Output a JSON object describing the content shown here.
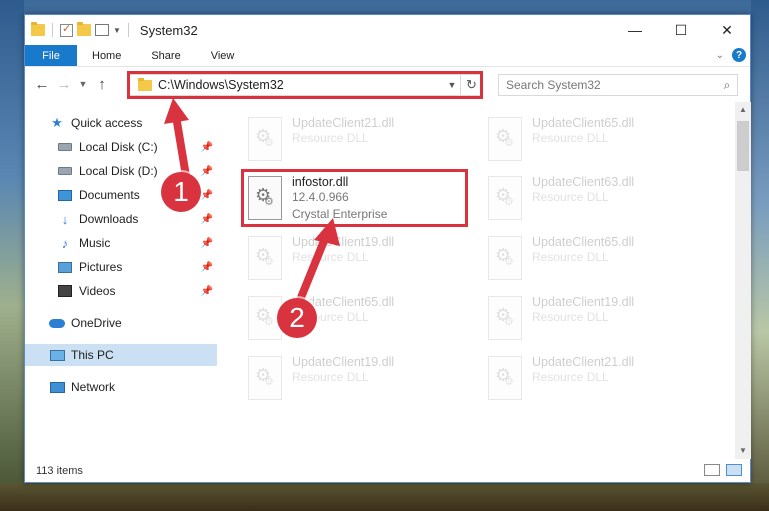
{
  "window": {
    "title": "System32",
    "controls": {
      "minimize": "—",
      "maximize": "☐",
      "close": "✕"
    }
  },
  "ribbon": {
    "tabs": [
      "File",
      "Home",
      "Share",
      "View"
    ],
    "help": "?"
  },
  "address": {
    "path": "C:\\Windows\\System32",
    "search_placeholder": "Search System32"
  },
  "sidebar": {
    "items": [
      {
        "label": "Quick access",
        "icon": "star-icon"
      },
      {
        "label": "Local Disk (C:)",
        "icon": "drive-icon",
        "pinned": true
      },
      {
        "label": "Local Disk (D:)",
        "icon": "drive-icon",
        "pinned": true
      },
      {
        "label": "Documents",
        "icon": "documents-icon",
        "pinned": true
      },
      {
        "label": "Downloads",
        "icon": "download-icon",
        "pinned": true
      },
      {
        "label": "Music",
        "icon": "music-icon",
        "pinned": true
      },
      {
        "label": "Pictures",
        "icon": "pictures-icon",
        "pinned": true
      },
      {
        "label": "Videos",
        "icon": "videos-icon",
        "pinned": true
      },
      {
        "label": "OneDrive",
        "icon": "onedrive-icon"
      },
      {
        "label": "This PC",
        "icon": "pc-icon",
        "selected": true
      },
      {
        "label": "Network",
        "icon": "network-icon"
      }
    ]
  },
  "files": [
    {
      "name": "UpdateClient21.dll",
      "sub1": "Resource DLL",
      "sub2": "",
      "faded": true
    },
    {
      "name": "UpdateClient65.dll",
      "sub1": "Resource DLL",
      "sub2": "",
      "faded": true
    },
    {
      "name": "infostor.dll",
      "sub1": "12.4.0.966",
      "sub2": "Crystal Enterprise",
      "faded": false
    },
    {
      "name": "UpdateClient63.dll",
      "sub1": "Resource DLL",
      "sub2": "",
      "faded": true
    },
    {
      "name": "UpdateClient19.dll",
      "sub1": "Resource DLL",
      "sub2": "",
      "faded": true
    },
    {
      "name": "UpdateClient65.dll",
      "sub1": "Resource DLL",
      "sub2": "",
      "faded": true
    },
    {
      "name": "UpdateClient65.dll",
      "sub1": "Resource DLL",
      "sub2": "",
      "faded": true
    },
    {
      "name": "UpdateClient19.dll",
      "sub1": "Resource DLL",
      "sub2": "",
      "faded": true
    },
    {
      "name": "UpdateClient19.dll",
      "sub1": "Resource DLL",
      "sub2": "",
      "faded": true
    },
    {
      "name": "UpdateClient21.dll",
      "sub1": "Resource DLL",
      "sub2": "",
      "faded": true
    }
  ],
  "status": {
    "item_count": "113 items"
  },
  "annotations": {
    "step1": "1",
    "step2": "2",
    "color": "#d9333f"
  }
}
